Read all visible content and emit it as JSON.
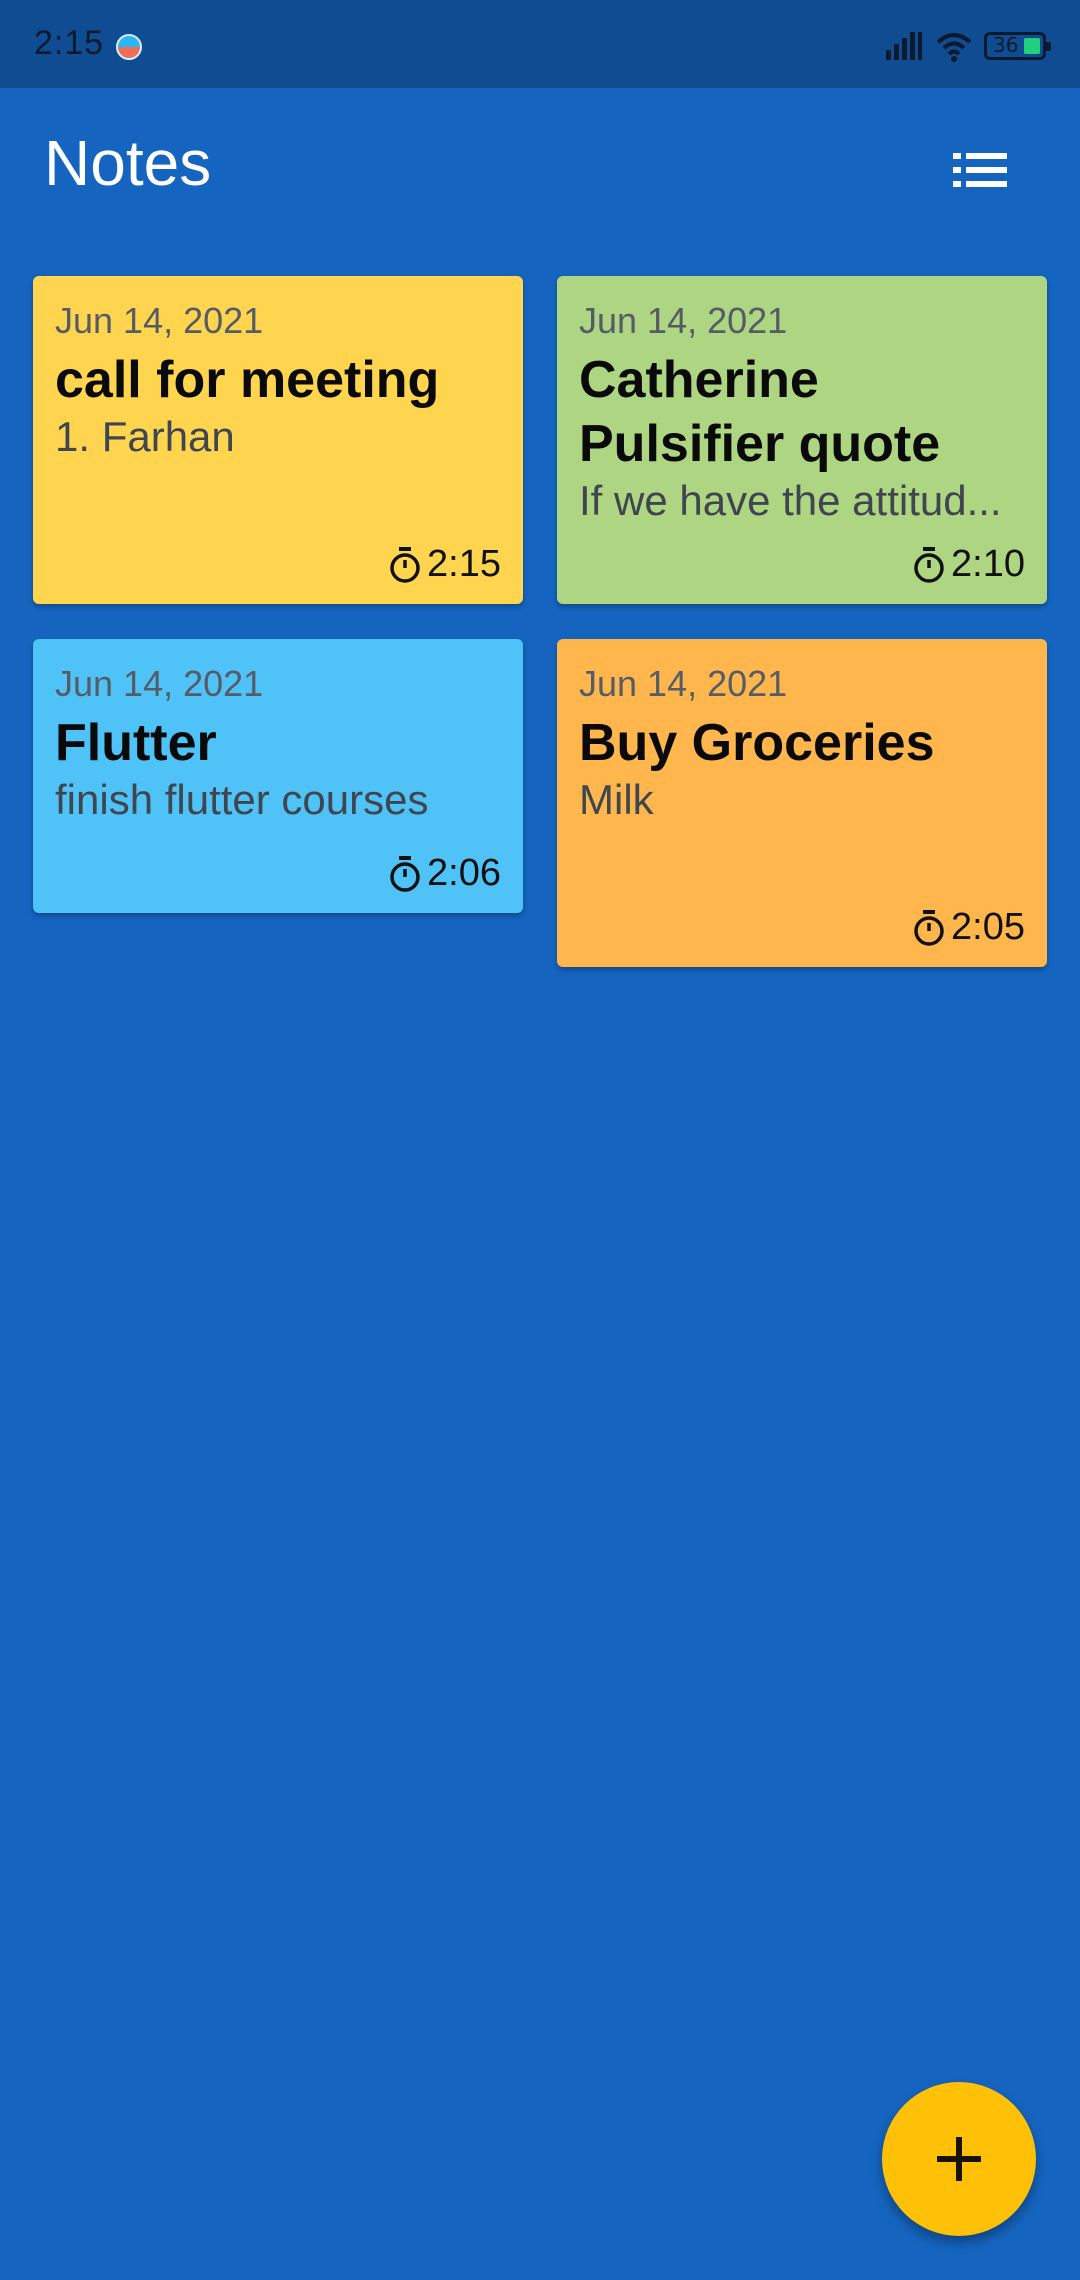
{
  "status_bar": {
    "time": "2:15",
    "battery_level": "36",
    "icons": [
      "app-notification-icon",
      "signal-icon",
      "wifi-icon",
      "battery-icon"
    ]
  },
  "app_bar": {
    "title": "Notes",
    "toggle_icon": "list-view-icon"
  },
  "notes": [
    {
      "date": "Jun 14, 2021",
      "title": "call for meeting",
      "body": "1. Farhan",
      "time": "2:15",
      "color": "#FFD54F"
    },
    {
      "date": "Jun 14, 2021",
      "title": "Catherine Pulsifier quote",
      "body": "If we have the attitud...",
      "time": "2:10",
      "color": "#AED581"
    },
    {
      "date": "Jun 14, 2021",
      "title": "Flutter",
      "body": "finish flutter courses",
      "time": "2:06",
      "color": "#4FC3F7"
    },
    {
      "date": "Jun 14, 2021",
      "title": "Buy Groceries",
      "body": "Milk",
      "time": "2:05",
      "color": "#FFB74D"
    }
  ],
  "fab": {
    "icon": "add-icon",
    "color": "#FFC107"
  },
  "colors": {
    "background": "#1565C0",
    "status_bar": "#0F4C91"
  }
}
